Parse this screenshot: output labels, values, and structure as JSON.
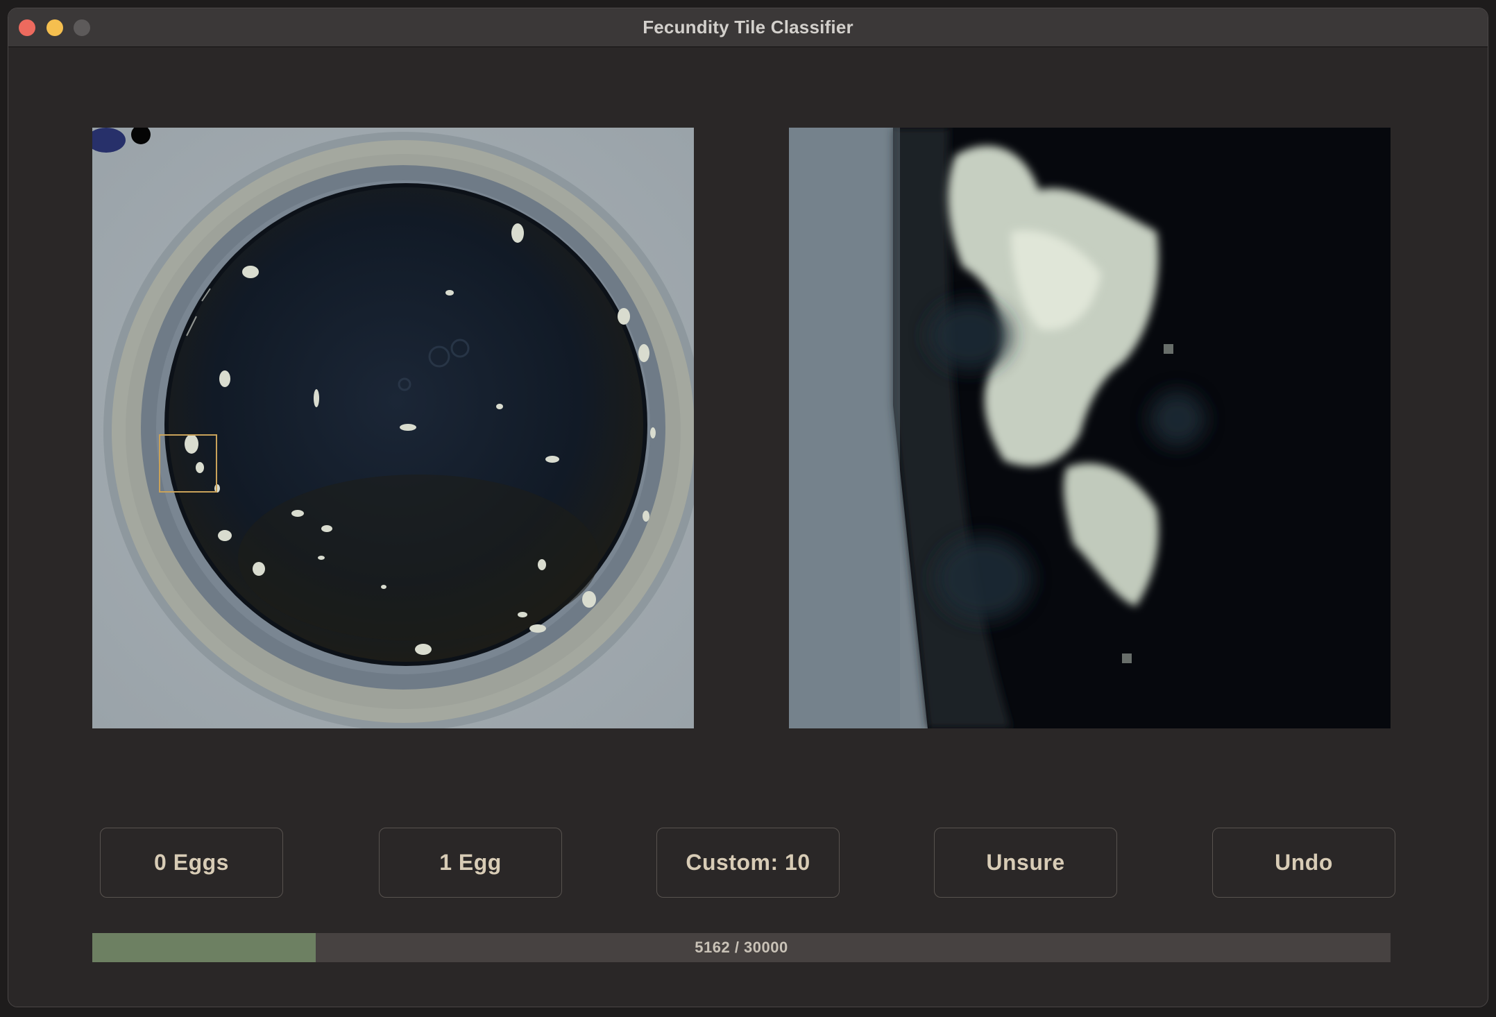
{
  "window": {
    "title": "Fecundity Tile Classifier"
  },
  "images": {
    "overview": "full-well-scan",
    "zoom": "selected-tile-zoom"
  },
  "buttons": {
    "zero_eggs": "0 Eggs",
    "one_egg": "1 Egg",
    "custom": "Custom: 10",
    "unsure": "Unsure",
    "undo": "Undo"
  },
  "progress": {
    "current": 5162,
    "total": 30000,
    "label": "5162 / 30000"
  },
  "colors": {
    "window_bg": "#2a2727",
    "button_text": "#d8ccb6",
    "progress_fill": "#6d8062",
    "progress_track": "#474241",
    "selection_box": "#c9a25a"
  }
}
